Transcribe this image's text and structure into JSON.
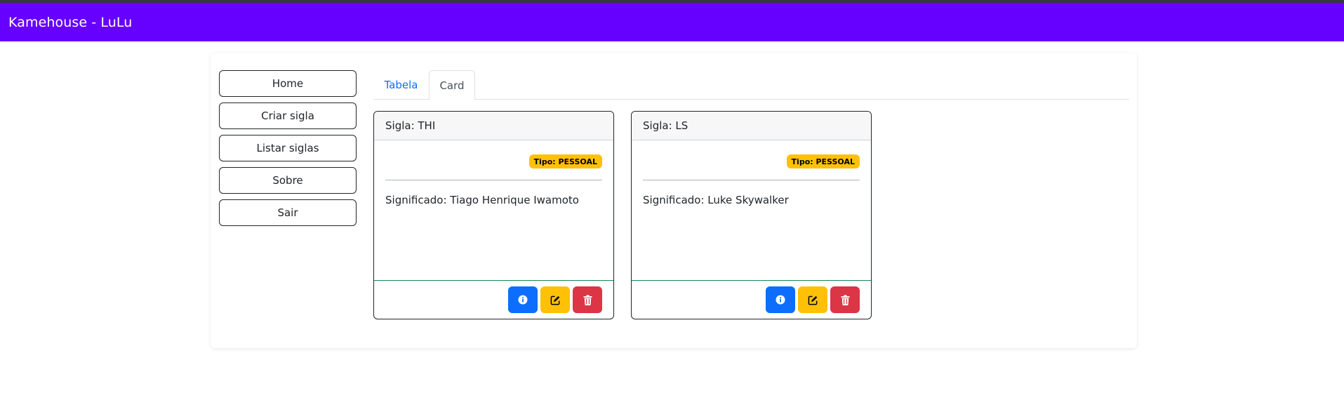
{
  "navbar": {
    "brand": "Kamehouse - LuLu"
  },
  "sidebar": {
    "items": [
      {
        "label": "Home"
      },
      {
        "label": "Criar sigla"
      },
      {
        "label": "Listar siglas"
      },
      {
        "label": "Sobre"
      },
      {
        "label": "Sair"
      }
    ]
  },
  "tabs": [
    {
      "label": "Tabela",
      "active": false
    },
    {
      "label": "Card",
      "active": true
    }
  ],
  "cards": [
    {
      "header": "Sigla: THI",
      "badge": "Tipo: PESSOAL",
      "meaning": "Significado: Tiago Henrique Iwamoto",
      "actions": [
        "info-icon",
        "edit-icon",
        "trash-icon"
      ]
    },
    {
      "header": "Sigla: LS",
      "badge": "Tipo: PESSOAL",
      "meaning": "Significado: Luke Skywalker",
      "actions": [
        "info-icon",
        "edit-icon",
        "trash-icon"
      ]
    }
  ],
  "colors": {
    "navbar": "#6600ff",
    "info": "#0d6efd",
    "warning": "#ffc107",
    "danger": "#dc3545"
  }
}
